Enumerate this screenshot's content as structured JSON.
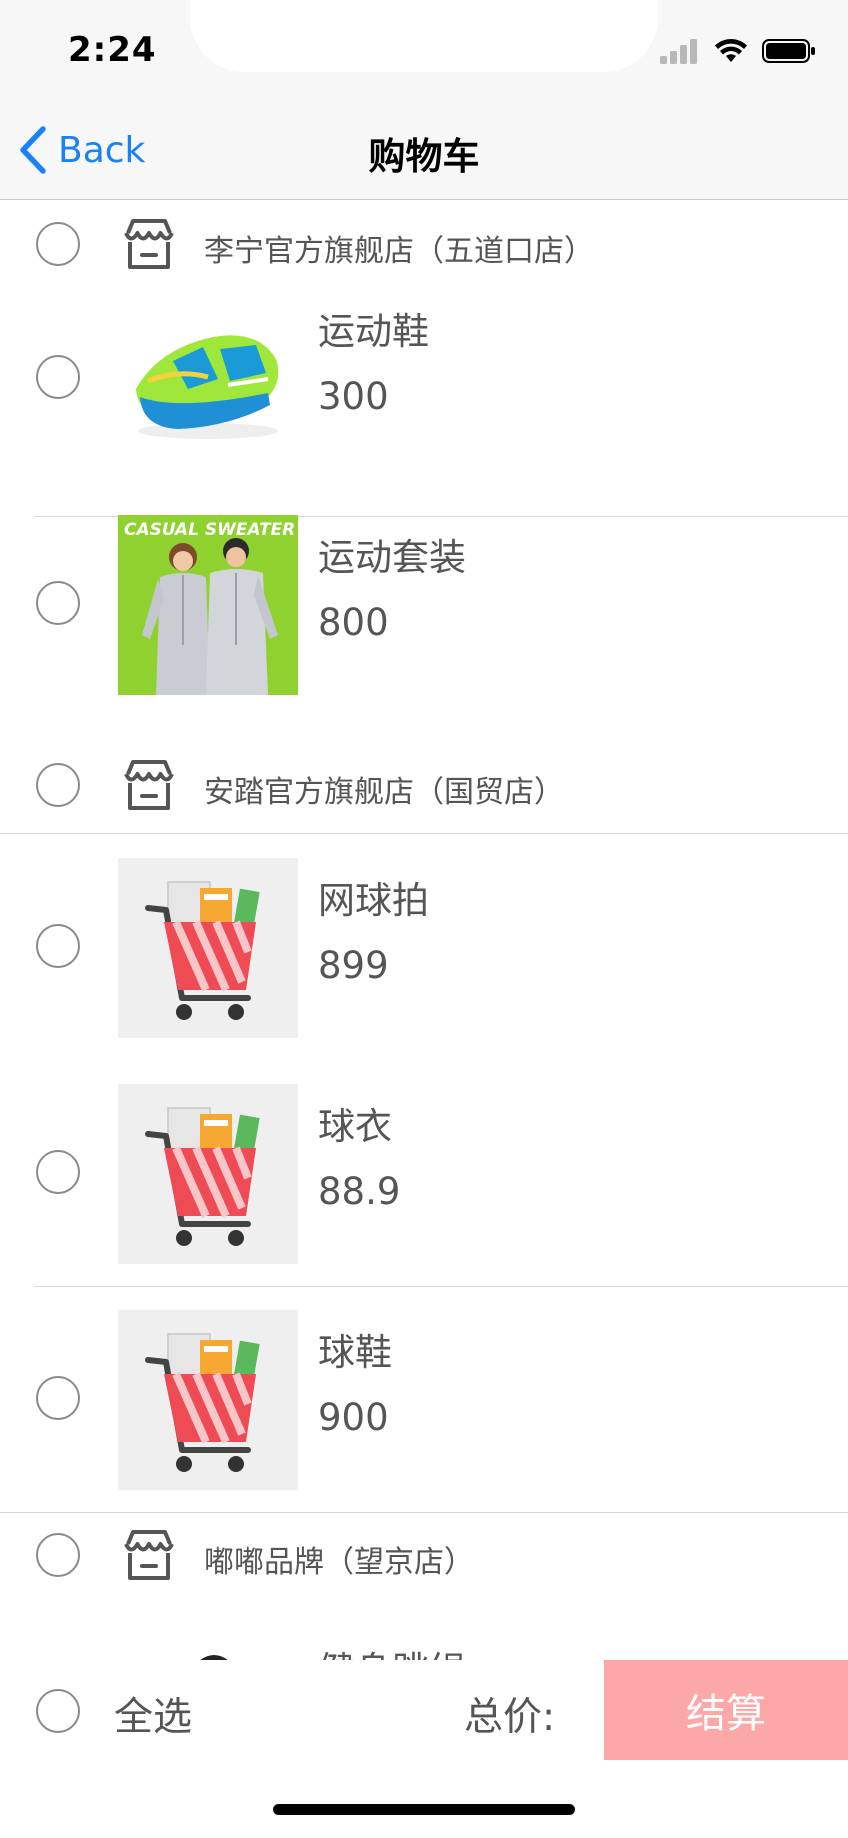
{
  "status_bar": {
    "time": "2:24"
  },
  "nav": {
    "back_label": "Back",
    "title": "购物车"
  },
  "shops": [
    {
      "name": "李宁官方旗舰店（五道口店）",
      "items": [
        {
          "name": "运动鞋",
          "price": "300",
          "image": "sneaker-photo"
        },
        {
          "name": "运动套装",
          "price": "800",
          "image": "tracksuit-photo"
        }
      ]
    },
    {
      "name": "安踏官方旗舰店（国贸店）",
      "items": [
        {
          "name": "网球拍",
          "price": "899",
          "image": "cart-placeholder"
        },
        {
          "name": "球衣",
          "price": "88.9",
          "image": "cart-placeholder"
        },
        {
          "name": "球鞋",
          "price": "900",
          "image": "cart-placeholder"
        }
      ]
    },
    {
      "name": "嘟嘟品牌（望京店）",
      "items": [
        {
          "name": "健身跳绳",
          "price": "",
          "image": "rope-photo"
        }
      ]
    }
  ],
  "footer": {
    "select_all": "全选",
    "total_label": "总价:",
    "total_value": "",
    "checkout": "结算"
  },
  "colors": {
    "accent": "#1a82f5",
    "checkout_bg": "#fda8a8",
    "nav_bg": "#f7f7f7",
    "text": "#555555"
  }
}
